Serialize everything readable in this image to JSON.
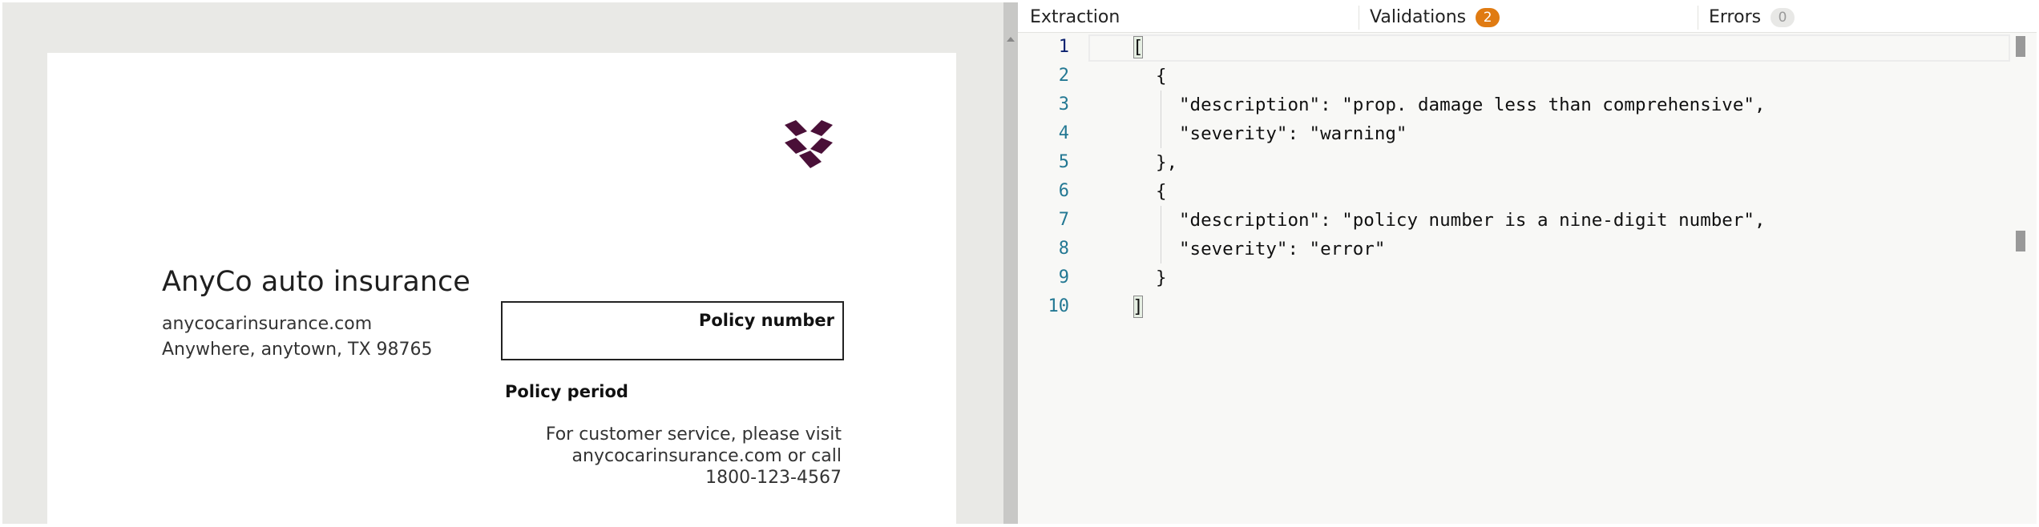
{
  "document": {
    "company_name": "AnyCo auto insurance",
    "website": "anycocarinsurance.com",
    "address": "Anywhere, anytown, TX 98765",
    "policy_number_label": "Policy number",
    "policy_period_label": "Policy period",
    "service_line1": "For customer service, please visit",
    "service_line2": "anycocarinsurance.com or call",
    "service_line3": "1800-123-4567",
    "logo_color": "#4a1038"
  },
  "tabs": {
    "extraction_label": "Extraction",
    "validations_label": "Validations",
    "validations_count": "2",
    "validations_badge_color": "#e07b12",
    "errors_label": "Errors",
    "errors_count": "0"
  },
  "editor": {
    "lines": [
      {
        "n": "1",
        "text": "["
      },
      {
        "n": "2",
        "text": "{"
      },
      {
        "n": "3",
        "text": "\"description\": \"prop. damage less than comprehensive\","
      },
      {
        "n": "4",
        "text": "\"severity\": \"warning\""
      },
      {
        "n": "5",
        "text": "},"
      },
      {
        "n": "6",
        "text": "{"
      },
      {
        "n": "7",
        "text": "\"description\": \"policy number is a nine-digit number\","
      },
      {
        "n": "8",
        "text": "\"severity\": \"error\""
      },
      {
        "n": "9",
        "text": "}"
      },
      {
        "n": "10",
        "text": "]"
      }
    ]
  }
}
